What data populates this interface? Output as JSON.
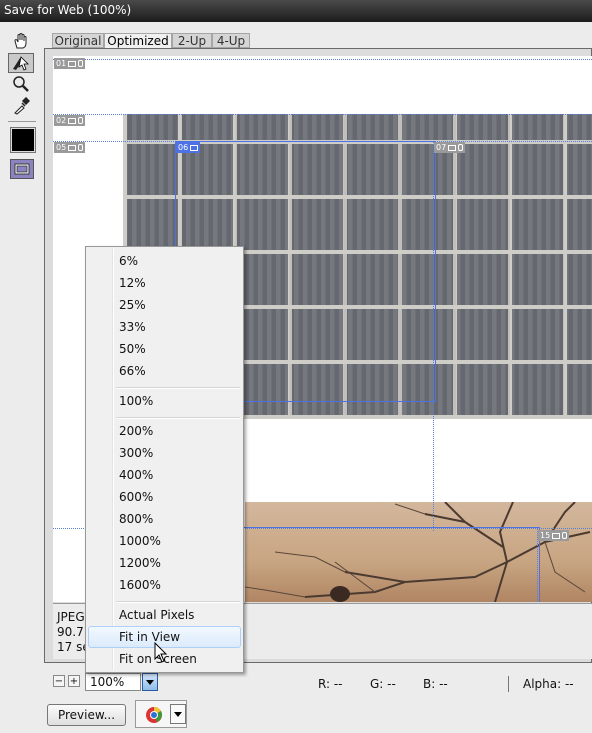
{
  "window": {
    "title": "Save for Web (100%)"
  },
  "tools": {
    "icons": [
      "hand-icon",
      "slice-select-icon",
      "zoom-icon",
      "eyedropper-icon",
      "eyedropper-color-swatch",
      "toggle-slices-visibility-icon"
    ]
  },
  "tabs": [
    {
      "label": "Original"
    },
    {
      "label": "Optimized"
    },
    {
      "label": "2-Up"
    },
    {
      "label": "4-Up"
    }
  ],
  "slices": {
    "s01": "01",
    "s02": "02",
    "s05": "05",
    "s06": "06",
    "s07": "07",
    "s15": "15"
  },
  "info": {
    "line1": "JPEG",
    "line2": "90.7",
    "line3": "17 se"
  },
  "zoom": {
    "minus": "−",
    "plus": "+",
    "value": "100%"
  },
  "readouts": {
    "r": "R: --",
    "g": "G: --",
    "b": "B: --",
    "alpha": "Alpha: --"
  },
  "buttons": {
    "preview": "Preview..."
  },
  "zoom_menu": {
    "group1": [
      "6%",
      "12%",
      "25%",
      "33%",
      "50%",
      "66%"
    ],
    "group2": [
      "100%"
    ],
    "group3": [
      "200%",
      "300%",
      "400%",
      "600%",
      "800%",
      "1000%",
      "1200%",
      "1600%"
    ],
    "group4": [
      "Actual Pixels",
      "Fit in View",
      "Fit on Screen"
    ],
    "highlighted": "Fit in View"
  },
  "colors": {
    "accent": "#4e72e3",
    "menu_highlight": "#dbebfc"
  }
}
